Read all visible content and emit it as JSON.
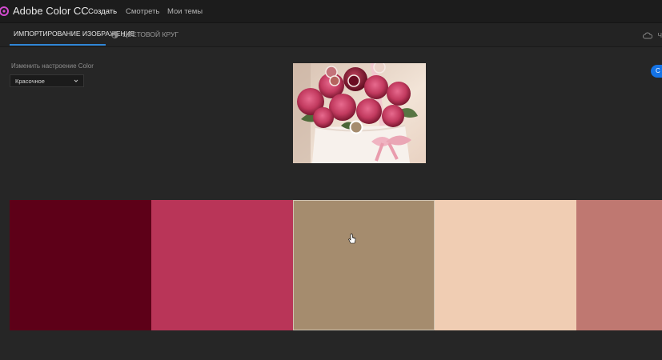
{
  "app": {
    "title": "Adobe Color CC",
    "accent_color": "#d34bd0",
    "nav": [
      {
        "label": "Создать",
        "active": true
      },
      {
        "label": "Смотреть",
        "active": false
      },
      {
        "label": "Мои темы",
        "active": false
      }
    ]
  },
  "subnav": {
    "tabs": [
      {
        "label": "ИМПОРТИРОВАНИЕ ИЗОБРАЖЕНИЕ",
        "icon": "image-icon",
        "active": true
      },
      {
        "label": "ЦВЕТОВОЙ КРУГ",
        "icon": "color-wheel-icon",
        "active": false
      }
    ],
    "right_text": "Ч",
    "right_icon": "cloud-icon",
    "tab_underline_color": "#2f86d6"
  },
  "mood": {
    "label": "Изменить настроение Color",
    "selected": "Красочное"
  },
  "action_button": {
    "label": "С",
    "color": "#1473e6"
  },
  "palette": {
    "selected_index": 2,
    "colors": [
      "#5d0018",
      "#b93558",
      "#a58c6e",
      "#f0cdb3",
      "#bf7871"
    ]
  },
  "sample_markers": [
    {
      "color": "#c4737a"
    },
    {
      "color": "#6a0c22"
    },
    {
      "color": "#ead2c8"
    },
    {
      "color": "#b5645e"
    },
    {
      "color": "#a58c6e"
    }
  ]
}
